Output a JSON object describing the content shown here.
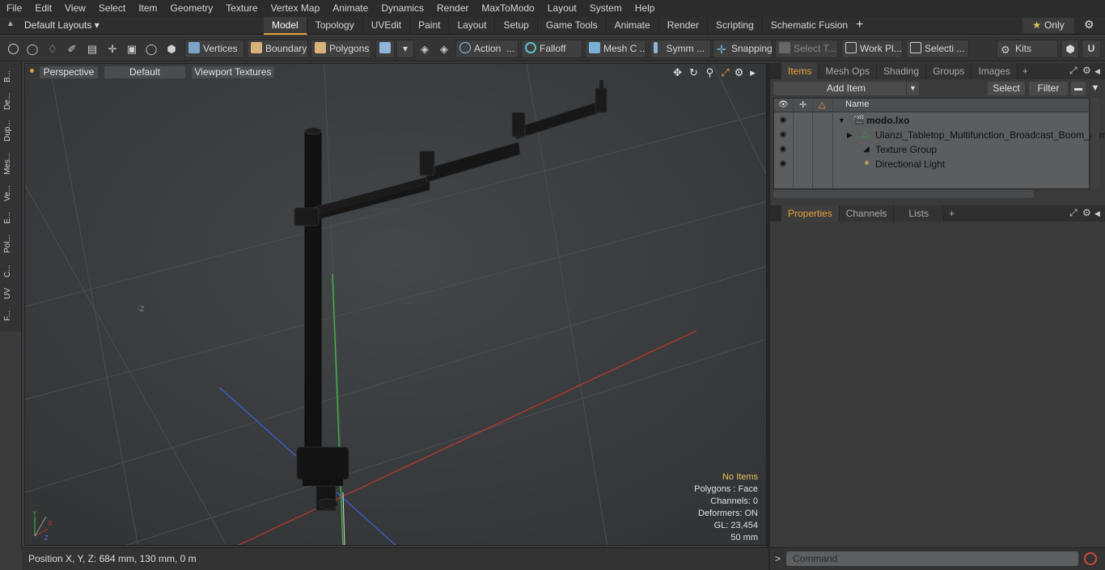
{
  "menu": [
    "File",
    "Edit",
    "View",
    "Select",
    "Item",
    "Geometry",
    "Texture",
    "Vertex Map",
    "Animate",
    "Dynamics",
    "Render",
    "MaxToModo",
    "Layout",
    "System",
    "Help"
  ],
  "layout_select": "Default Layouts ▾",
  "layout_tabs": [
    "Model",
    "Topology",
    "UVEdit",
    "Paint",
    "Layout",
    "Setup",
    "Game Tools",
    "Animate",
    "Render",
    "Scripting",
    "Schematic Fusion"
  ],
  "layout_tabs_active": "Model",
  "only_label": "Only",
  "toolbar": {
    "vertices": "Vertices",
    "boundary": "Boundary",
    "polygons": "Polygons",
    "action": "Action",
    "falloff": "Falloff",
    "mesh": "Mesh C ...",
    "symmetry": "Symm ...",
    "snapping": "Snapping",
    "select_t": "Select T...",
    "work_plane": "Work Pl...",
    "selection": "Selecti ...",
    "kits": "Kits"
  },
  "left_tabs": [
    "B...",
    "De...",
    "Dup...",
    "Mes...",
    "Ve...",
    "E...",
    "Pol...",
    "C...",
    "UV",
    "F..."
  ],
  "viewport": {
    "view_mode": "Perspective",
    "shading": "Default",
    "textures": "Viewport Textures",
    "axis_z_label": "-Z",
    "info": {
      "selection": "No Items",
      "polygons": "Polygons : Face",
      "channels": "Channels: 0",
      "deformers": "Deformers: ON",
      "gl": "GL: 23,454",
      "scale": "50 mm"
    }
  },
  "status": "Position X, Y, Z:   684 mm, 130 mm, 0 m",
  "items_panel": {
    "tabs": [
      "Items",
      "Mesh Ops",
      "Shading",
      "Groups",
      "Images"
    ],
    "active_tab": "Items",
    "add_item": "Add Item",
    "select": "Select",
    "filter": "Filter",
    "column_name": "Name",
    "rows": [
      {
        "label": "modo.lxo",
        "bold": true
      },
      {
        "label": "Ulanzi_Tabletop_Multifunction_Broadcast_Boom_Arm"
      },
      {
        "label": "Texture Group"
      },
      {
        "label": "Directional Light"
      }
    ]
  },
  "props_panel": {
    "tabs": [
      "Properties",
      "Channels",
      "Lists"
    ],
    "active_tab": "Properties"
  },
  "command": {
    "prompt": ">",
    "placeholder": "Command"
  },
  "colors": {
    "accent": "#e8a23a",
    "axis_x": "#c0392b",
    "axis_y": "#3fbf3f",
    "axis_z": "#3f5fd0"
  }
}
